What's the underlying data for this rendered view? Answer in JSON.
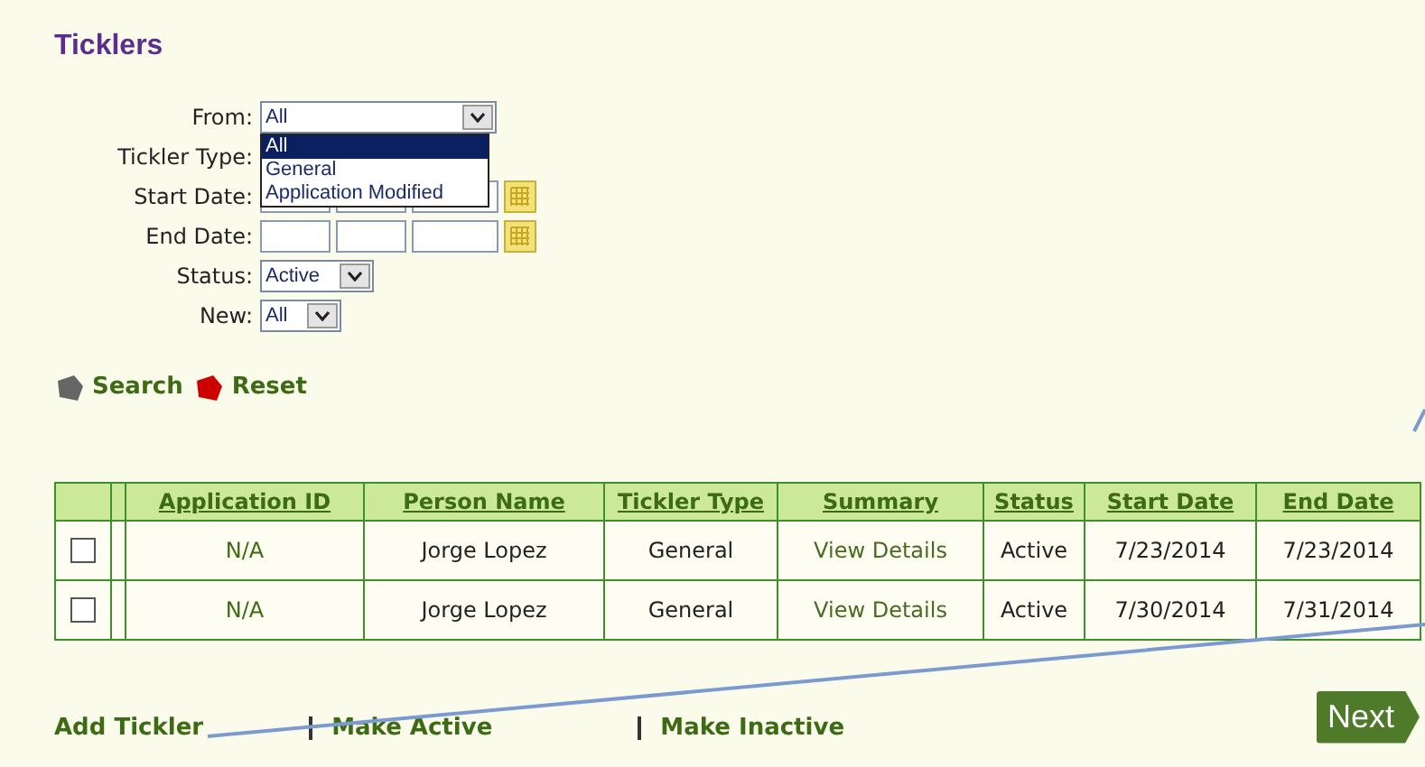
{
  "title": "Ticklers",
  "filters": [
    {
      "kind": "select",
      "label": "From:",
      "value": "All",
      "expanded": true,
      "options": [
        {
          "label": "All",
          "selected": true
        },
        {
          "label": "General",
          "selected": false
        },
        {
          "label": "Application Modified",
          "selected": false
        }
      ]
    },
    {
      "kind": "select",
      "label": "Tickler Type:"
    },
    {
      "kind": "date",
      "label": "Start Date:"
    },
    {
      "kind": "date",
      "label": "End Date:"
    },
    {
      "kind": "select",
      "label": "Status:",
      "value": "Active"
    },
    {
      "kind": "select",
      "label": "New:",
      "value": "All"
    }
  ],
  "actions": [
    {
      "label": "Search",
      "color": "#666666"
    },
    {
      "label": "Reset",
      "color": "#cc0000"
    }
  ],
  "table": {
    "columns": [
      "Application ID",
      "Person Name",
      "Tickler Type",
      "Summary",
      "Status",
      "Start Date",
      "End Date"
    ],
    "rows": [
      {
        "checked": false,
        "cells": [
          "N/A",
          "Jorge Lopez",
          "General",
          "View Details",
          "Active",
          "7/23/2014",
          "7/23/2014"
        ]
      },
      {
        "checked": false,
        "cells": [
          "N/A",
          "Jorge Lopez",
          "General",
          "View Details",
          "Active",
          "7/30/2014",
          "7/31/2014"
        ]
      }
    ]
  },
  "links": [
    "Add Tickler",
    "Make Active",
    "Make Inactive"
  ],
  "next_button": "Next"
}
